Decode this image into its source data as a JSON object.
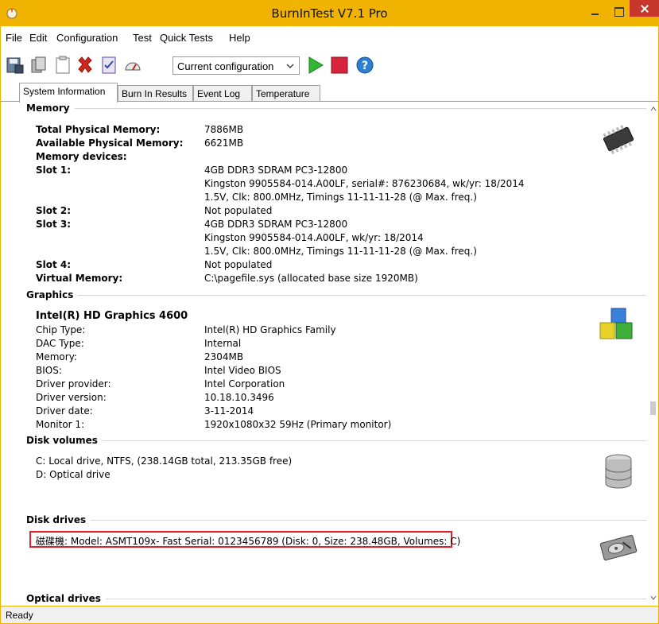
{
  "window": {
    "title": "BurnInTest V7.1 Pro",
    "app_icon": "burnintest-app-icon"
  },
  "menu": {
    "items": [
      "File",
      "Edit",
      "Configuration",
      "Test",
      "Quick Tests",
      "Help"
    ]
  },
  "toolbar": {
    "icons": [
      "save-results-icon",
      "copy-icon",
      "clipboard-icon",
      "delete-icon",
      "checklist-icon",
      "gauge-icon",
      "play-icon",
      "stop-icon",
      "help-icon"
    ],
    "config_select": "Current configuration"
  },
  "tabs": [
    "System Information",
    "Burn In Results",
    "Event Log",
    "Temperature"
  ],
  "memory": {
    "heading": "Memory",
    "rows": [
      {
        "label": "Total Physical Memory:",
        "value": "7886MB"
      },
      {
        "label": "Available Physical Memory:",
        "value": "6621MB"
      },
      {
        "label": "Memory devices:",
        "value": ""
      },
      {
        "label": "Slot 1:",
        "value": "4GB DDR3 SDRAM PC3-12800"
      },
      {
        "label": "",
        "value": "Kingston 9905584-014.A00LF, serial#: 876230684, wk/yr: 18/2014"
      },
      {
        "label": "",
        "value": "1.5V, Clk: 800.0MHz, Timings 11-11-11-28 (@ Max. freq.)"
      },
      {
        "label": "Slot 2:",
        "value": "Not populated"
      },
      {
        "label": "Slot 3:",
        "value": "4GB DDR3 SDRAM PC3-12800"
      },
      {
        "label": "",
        "value": "Kingston 9905584-014.A00LF, wk/yr: 18/2014"
      },
      {
        "label": "",
        "value": "1.5V, Clk: 800.0MHz, Timings 11-11-11-28 (@ Max. freq.)"
      },
      {
        "label": "Slot 4:",
        "value": "Not populated"
      },
      {
        "label": "Virtual Memory:",
        "value": "C:\\pagefile.sys (allocated base size 1920MB)"
      }
    ]
  },
  "graphics": {
    "heading": "Graphics",
    "adapter": "Intel(R) HD Graphics 4600",
    "rows": [
      {
        "label": "Chip Type:",
        "value": "Intel(R) HD Graphics Family"
      },
      {
        "label": "DAC Type:",
        "value": "Internal"
      },
      {
        "label": "Memory:",
        "value": "2304MB"
      },
      {
        "label": "BIOS:",
        "value": "Intel Video BIOS"
      },
      {
        "label": "Driver provider:",
        "value": "Intel Corporation"
      },
      {
        "label": "Driver version:",
        "value": "10.18.10.3496"
      },
      {
        "label": "Driver date:",
        "value": "3-11-2014"
      },
      {
        "label": "Monitor 1:",
        "value": "1920x1080x32 59Hz (Primary monitor)"
      }
    ]
  },
  "disk_volumes": {
    "heading": "Disk volumes",
    "items": [
      "C:  Local drive, NTFS, (238.14GB total, 213.35GB free)",
      "D:  Optical drive"
    ]
  },
  "disk_drives": {
    "heading": "Disk drives",
    "items": [
      "磁碟機: Model: ASMT109x- Fast Serial: 0123456789 (Disk: 0, Size: 238.48GB, Volumes: C)"
    ]
  },
  "optical_drives": {
    "heading": "Optical drives"
  },
  "status": {
    "text": "Ready"
  }
}
